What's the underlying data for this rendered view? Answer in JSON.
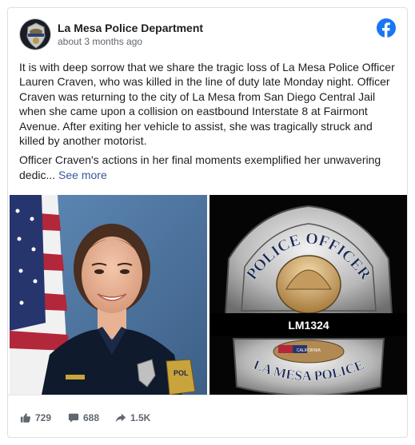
{
  "post": {
    "page_name": "La Mesa Police Department",
    "timestamp": "about 3 months ago",
    "paragraph1": "It is with deep sorrow that we share the tragic loss of La Mesa Police Officer Lauren Craven, who was killed in the line of duty late Monday night.  Officer Craven was returning to the city of La Mesa from San Diego Central Jail when she came upon a collision on eastbound Interstate 8 at Fairmont Avenue.  After exiting her vehicle to assist, she was tragically struck and killed by another motorist.",
    "paragraph2": "Officer Craven's actions in her final moments exemplified her unwavering dedic...",
    "see_more": "See more"
  },
  "media": {
    "badge_top_text": "POLICE OFFICER",
    "badge_number": "LM1324",
    "badge_bottom_text": "LA MESA POLICE",
    "badge_state_text": "CALIFORNIA",
    "patch_text": "POL"
  },
  "stats": {
    "likes": "729",
    "comments": "688",
    "shares": "1.5K"
  },
  "icons": {
    "logo": "facebook-logo-icon",
    "like": "thumbs-up-icon",
    "comment": "comment-bubble-icon",
    "share": "share-arrow-icon"
  },
  "colors": {
    "facebook_blue": "#1877f2",
    "link": "#385898",
    "meta_text": "#606770"
  }
}
